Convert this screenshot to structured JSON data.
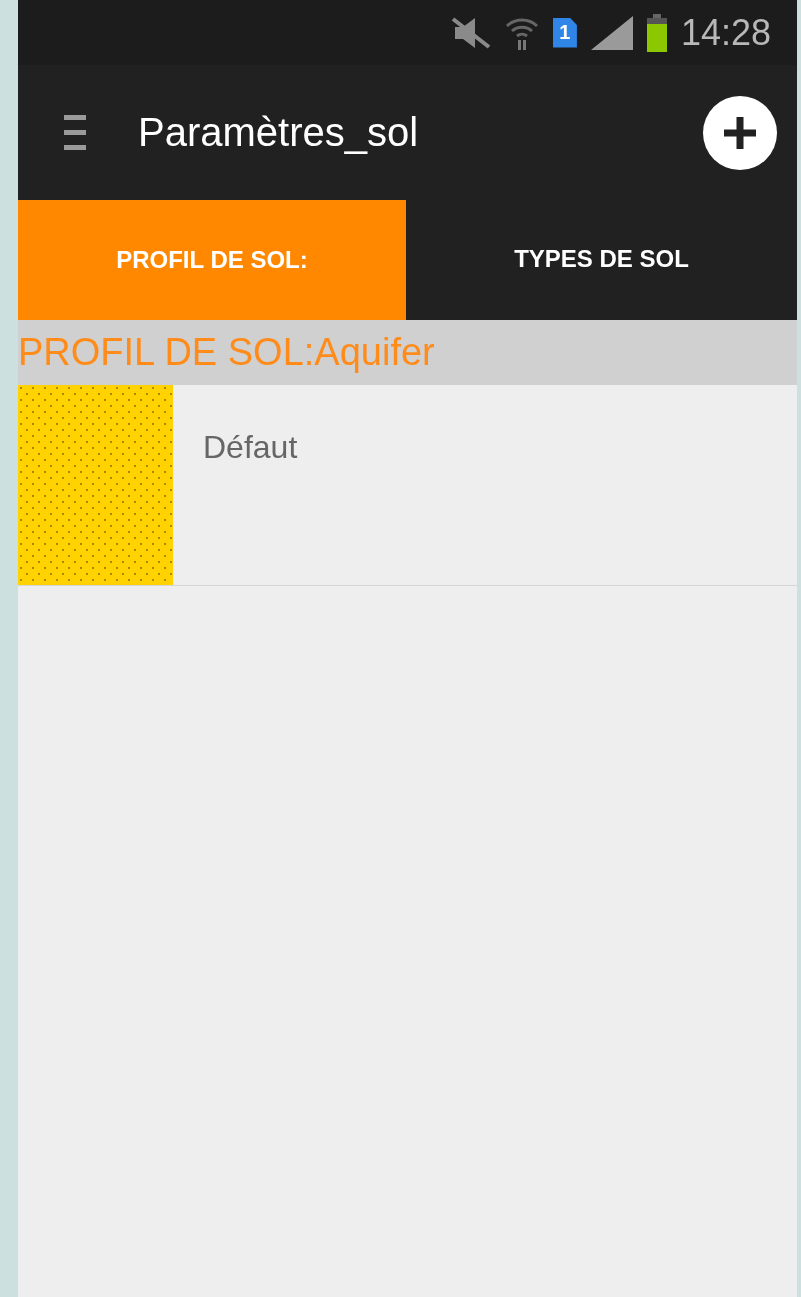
{
  "status_bar": {
    "sim_slot": "1",
    "time": "14:28"
  },
  "action_bar": {
    "title": "Paramètres_sol"
  },
  "tabs": [
    {
      "label": "PROFIL DE SOL:",
      "selected": true
    },
    {
      "label": "TYPES DE SOL",
      "selected": false
    }
  ],
  "section_header": "PROFIL DE SOL:Aquifer",
  "layers": [
    {
      "name": "Défaut",
      "color": "#ffd200"
    }
  ]
}
